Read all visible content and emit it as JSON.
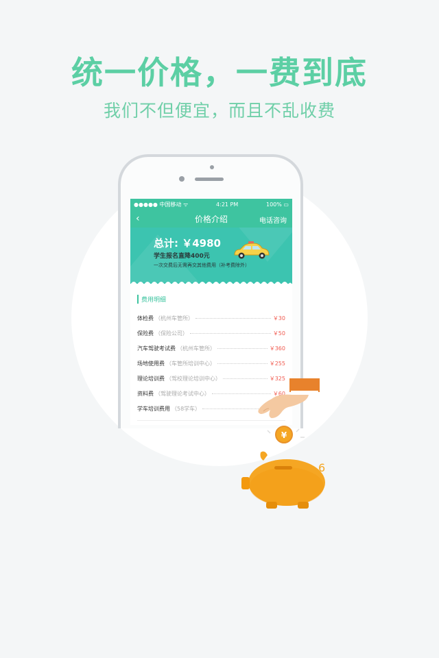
{
  "headline": "统一价格，一费到底",
  "subline": "我们不但便宜，而且不乱收费",
  "phone": {
    "status": {
      "carrier": "●●●●● 中国移动 ᯤ",
      "time": "4:21 PM",
      "battery": "100% ▭"
    },
    "nav": {
      "back_icon": "chevron-left",
      "back": "‹",
      "title": "价格介绍",
      "right": "电话咨询"
    },
    "banner": {
      "total": "总计: ￥4980",
      "line2": "学生报名直降400元",
      "line3": "一次交费后无需再交其他费用（补考费除外）"
    },
    "fees": {
      "title": "费用明细",
      "rows": [
        {
          "name": "体检费",
          "note": "（杭州车管所）",
          "price": "￥30"
        },
        {
          "name": "保险费",
          "note": "（保险公司）",
          "price": "￥50"
        },
        {
          "name": "汽车驾驶考试费",
          "note": "（杭州车管所）",
          "price": "￥360"
        },
        {
          "name": "场地使用费",
          "note": "（车管所培训中心）",
          "price": "￥255"
        },
        {
          "name": "理论培训费",
          "note": "（驾校理论培训中心）",
          "price": "￥325"
        },
        {
          "name": "资料费",
          "note": "（驾驶理论考试中心）",
          "price": "￥60"
        },
        {
          "name": "学车培训费用",
          "note": "（58学车）",
          "price": ""
        }
      ]
    }
  },
  "illustration": {
    "coin_symbol": "¥",
    "pig_mark": "6"
  },
  "colors": {
    "accent": "#5ccfa4",
    "teal": "#3ec4a0",
    "price": "#f05a4f",
    "pig": "#f5a623"
  }
}
